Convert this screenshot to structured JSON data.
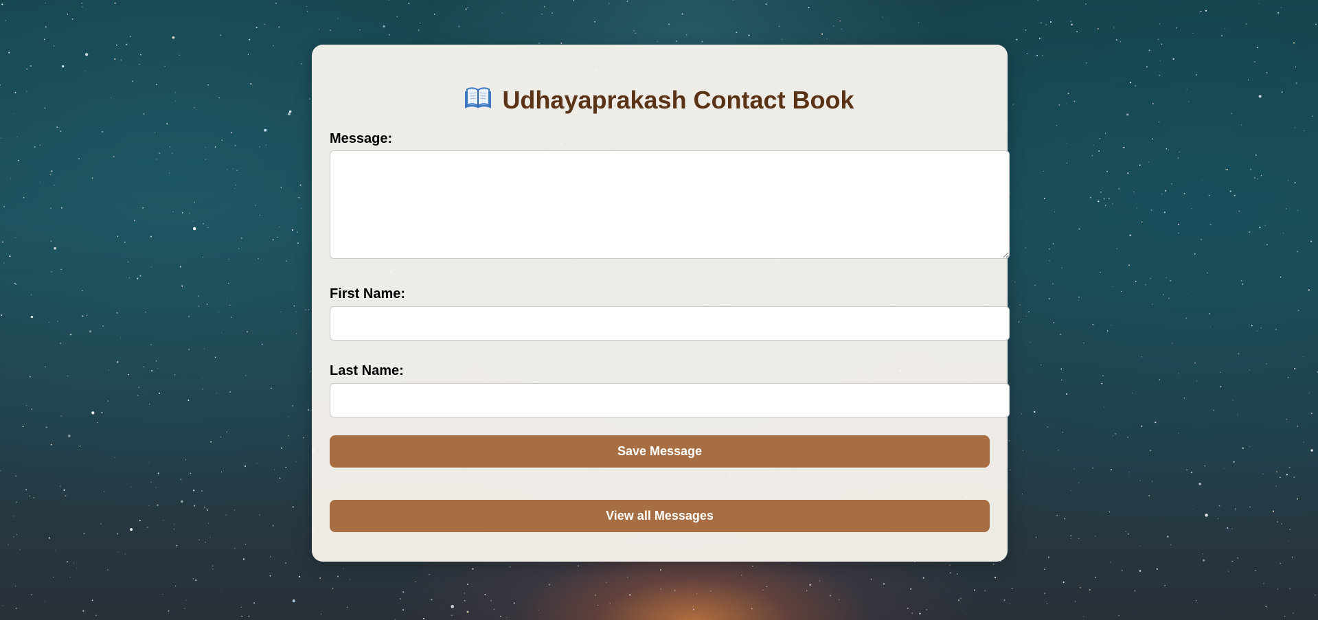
{
  "app": {
    "title": "Udhayaprakash Contact Book",
    "title_icon": "open-book-icon"
  },
  "form": {
    "message_label": "Message:",
    "message_value": "",
    "first_name_label": "First Name:",
    "first_name_value": "",
    "last_name_label": "Last Name:",
    "last_name_value": ""
  },
  "actions": {
    "save_label": "Save Message",
    "view_all_label": "View all Messages"
  },
  "colors": {
    "button": "#a66e42",
    "title": "#5a3316",
    "card": "#f7f2ec"
  }
}
